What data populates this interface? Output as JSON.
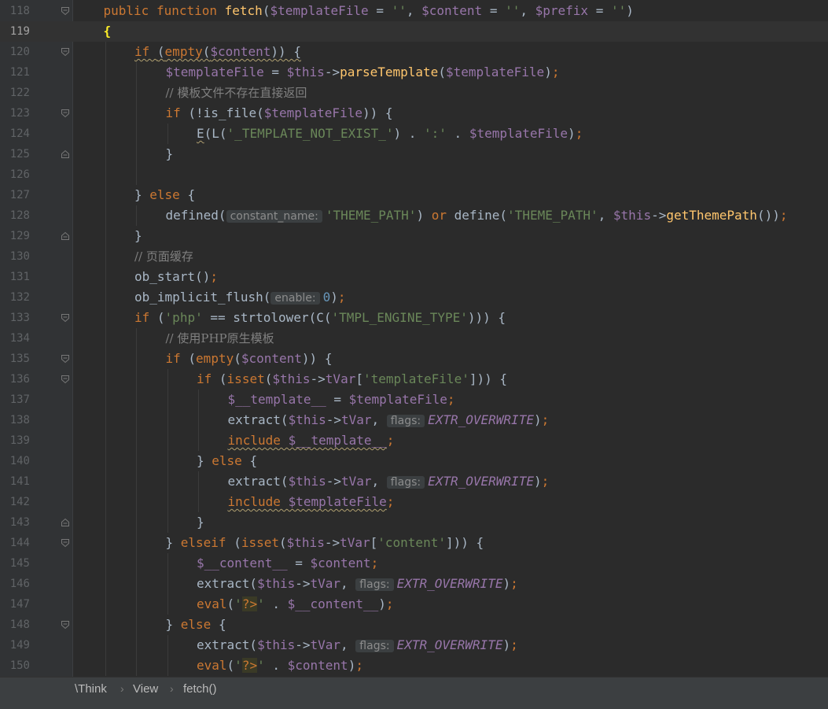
{
  "colors": {
    "background": "#2b2b2b",
    "gutter": "#313335",
    "keyword": "#cc7832",
    "function": "#ffc66d",
    "variable": "#9876aa",
    "string": "#6a8759",
    "number": "#6897bb",
    "comment": "#808080",
    "text": "#a9b7c6"
  },
  "current_line": 119,
  "breadcrumbs": [
    "\\Think",
    "View",
    "fetch()"
  ],
  "lines": [
    {
      "n": 118,
      "indent": 1,
      "fold": "open",
      "tokens": [
        [
          "kw",
          "public "
        ],
        [
          "kw",
          "function "
        ],
        [
          "fn",
          "fetch"
        ],
        [
          "plain",
          "("
        ],
        [
          "var",
          "$templateFile"
        ],
        [
          "plain",
          " = "
        ],
        [
          "str",
          "''"
        ],
        [
          "plain",
          ", "
        ],
        [
          "var",
          "$content"
        ],
        [
          "plain",
          " = "
        ],
        [
          "str",
          "''"
        ],
        [
          "plain",
          ", "
        ],
        [
          "var",
          "$prefix"
        ],
        [
          "plain",
          " = "
        ],
        [
          "str",
          "''"
        ],
        [
          "plain",
          ")"
        ]
      ]
    },
    {
      "n": 119,
      "indent": 1,
      "fold": "",
      "tokens": [
        [
          "hl",
          "{"
        ]
      ]
    },
    {
      "n": 120,
      "indent": 2,
      "fold": "open",
      "tokens": [
        [
          "kw",
          "if ",
          "w"
        ],
        [
          "plain",
          "(",
          "w"
        ],
        [
          "kw",
          "empty",
          "w"
        ],
        [
          "plain",
          "(",
          "w"
        ],
        [
          "var",
          "$content",
          "w"
        ],
        [
          "plain",
          ")) {",
          "w"
        ]
      ]
    },
    {
      "n": 121,
      "indent": 3,
      "fold": "",
      "tokens": [
        [
          "var",
          "$templateFile"
        ],
        [
          "plain",
          " = "
        ],
        [
          "var",
          "$this"
        ],
        [
          "plain",
          "->"
        ],
        [
          "fn",
          "parseTemplate"
        ],
        [
          "plain",
          "("
        ],
        [
          "var",
          "$templateFile"
        ],
        [
          "plain",
          ")"
        ],
        [
          "kw",
          ";"
        ]
      ]
    },
    {
      "n": 122,
      "indent": 3,
      "fold": "",
      "tokens": [
        [
          "cm",
          "// 模板文件不存在直接返回"
        ]
      ]
    },
    {
      "n": 123,
      "indent": 3,
      "fold": "open",
      "tokens": [
        [
          "kw",
          "if "
        ],
        [
          "plain",
          "(!is_file("
        ],
        [
          "var",
          "$templateFile"
        ],
        [
          "plain",
          ")) {"
        ]
      ]
    },
    {
      "n": 124,
      "indent": 4,
      "fold": "",
      "tokens": [
        [
          "plain",
          "E",
          "w"
        ],
        [
          "plain",
          "(L("
        ],
        [
          "str",
          "'_TEMPLATE_NOT_EXIST_'"
        ],
        [
          "plain",
          ") . "
        ],
        [
          "str",
          "':'"
        ],
        [
          "plain",
          " . "
        ],
        [
          "var",
          "$templateFile"
        ],
        [
          "plain",
          ")"
        ],
        [
          "kw",
          ";"
        ]
      ]
    },
    {
      "n": 125,
      "indent": 3,
      "fold": "close",
      "tokens": [
        [
          "plain",
          "}"
        ]
      ]
    },
    {
      "n": 126,
      "indent": 0,
      "fold": "",
      "tokens": []
    },
    {
      "n": 127,
      "indent": 2,
      "fold": "",
      "tokens": [
        [
          "plain",
          "} "
        ],
        [
          "kw",
          "else "
        ],
        [
          "plain",
          "{"
        ]
      ]
    },
    {
      "n": 128,
      "indent": 3,
      "fold": "",
      "tokens": [
        [
          "plain",
          "defined("
        ],
        [
          "hint",
          "constant_name:"
        ],
        [
          "str",
          "'THEME_PATH'"
        ],
        [
          "plain",
          ") "
        ],
        [
          "kw",
          "or "
        ],
        [
          "plain",
          "define("
        ],
        [
          "str",
          "'THEME_PATH'"
        ],
        [
          "plain",
          ", "
        ],
        [
          "var",
          "$this"
        ],
        [
          "plain",
          "->"
        ],
        [
          "fn",
          "getThemePath"
        ],
        [
          "plain",
          "())"
        ],
        [
          "kw",
          ";"
        ]
      ]
    },
    {
      "n": 129,
      "indent": 2,
      "fold": "close",
      "tokens": [
        [
          "plain",
          "}"
        ]
      ]
    },
    {
      "n": 130,
      "indent": 2,
      "fold": "",
      "tokens": [
        [
          "cm",
          "// 页面缓存"
        ]
      ]
    },
    {
      "n": 131,
      "indent": 2,
      "fold": "",
      "tokens": [
        [
          "plain",
          "ob_start()"
        ],
        [
          "kw",
          ";"
        ]
      ]
    },
    {
      "n": 132,
      "indent": 2,
      "fold": "",
      "tokens": [
        [
          "plain",
          "ob_implicit_flush("
        ],
        [
          "hint",
          "enable:"
        ],
        [
          "num",
          "0"
        ],
        [
          "plain",
          ")"
        ],
        [
          "kw",
          ";"
        ]
      ]
    },
    {
      "n": 133,
      "indent": 2,
      "fold": "open",
      "tokens": [
        [
          "kw",
          "if "
        ],
        [
          "plain",
          "("
        ],
        [
          "str",
          "'php'"
        ],
        [
          "plain",
          " == strtolower(C("
        ],
        [
          "str",
          "'TMPL_ENGINE_TYPE'"
        ],
        [
          "plain",
          "))) {"
        ]
      ]
    },
    {
      "n": 134,
      "indent": 3,
      "fold": "",
      "tokens": [
        [
          "cm",
          "// 使用PHP原生模板"
        ]
      ]
    },
    {
      "n": 135,
      "indent": 3,
      "fold": "open",
      "tokens": [
        [
          "kw",
          "if "
        ],
        [
          "plain",
          "("
        ],
        [
          "kw",
          "empty"
        ],
        [
          "plain",
          "("
        ],
        [
          "var",
          "$content"
        ],
        [
          "plain",
          ")) {"
        ]
      ]
    },
    {
      "n": 136,
      "indent": 4,
      "fold": "open",
      "tokens": [
        [
          "kw",
          "if "
        ],
        [
          "plain",
          "("
        ],
        [
          "kw",
          "isset"
        ],
        [
          "plain",
          "("
        ],
        [
          "var",
          "$this"
        ],
        [
          "plain",
          "->"
        ],
        [
          "var",
          "tVar"
        ],
        [
          "plain",
          "["
        ],
        [
          "str",
          "'templateFile'"
        ],
        [
          "plain",
          "])) {"
        ]
      ]
    },
    {
      "n": 137,
      "indent": 5,
      "fold": "",
      "tokens": [
        [
          "var",
          "$__template__"
        ],
        [
          "plain",
          " = "
        ],
        [
          "var",
          "$templateFile"
        ],
        [
          "kw",
          ";"
        ]
      ]
    },
    {
      "n": 138,
      "indent": 5,
      "fold": "",
      "tokens": [
        [
          "plain",
          "extract("
        ],
        [
          "var",
          "$this"
        ],
        [
          "plain",
          "->"
        ],
        [
          "var",
          "tVar"
        ],
        [
          "plain",
          ", "
        ],
        [
          "hint",
          "flags:"
        ],
        [
          "const",
          "EXTR_OVERWRITE"
        ],
        [
          "plain",
          ")"
        ],
        [
          "kw",
          ";"
        ]
      ]
    },
    {
      "n": 139,
      "indent": 5,
      "fold": "",
      "tokens": [
        [
          "kw",
          "include ",
          "w"
        ],
        [
          "var",
          "$__template__",
          "w"
        ],
        [
          "kw",
          ";"
        ]
      ]
    },
    {
      "n": 140,
      "indent": 4,
      "fold": "",
      "tokens": [
        [
          "plain",
          "} "
        ],
        [
          "kw",
          "else "
        ],
        [
          "plain",
          "{"
        ]
      ]
    },
    {
      "n": 141,
      "indent": 5,
      "fold": "",
      "tokens": [
        [
          "plain",
          "extract("
        ],
        [
          "var",
          "$this"
        ],
        [
          "plain",
          "->"
        ],
        [
          "var",
          "tVar"
        ],
        [
          "plain",
          ", "
        ],
        [
          "hint",
          "flags:"
        ],
        [
          "const",
          "EXTR_OVERWRITE"
        ],
        [
          "plain",
          ")"
        ],
        [
          "kw",
          ";"
        ]
      ]
    },
    {
      "n": 142,
      "indent": 5,
      "fold": "",
      "tokens": [
        [
          "kw",
          "include ",
          "w"
        ],
        [
          "var",
          "$templateFile",
          "w"
        ],
        [
          "kw",
          ";"
        ]
      ]
    },
    {
      "n": 143,
      "indent": 4,
      "fold": "close",
      "tokens": [
        [
          "plain",
          "}"
        ]
      ]
    },
    {
      "n": 144,
      "indent": 3,
      "fold": "open",
      "tokens": [
        [
          "plain",
          "} "
        ],
        [
          "kw",
          "elseif "
        ],
        [
          "plain",
          "("
        ],
        [
          "kw",
          "isset"
        ],
        [
          "plain",
          "("
        ],
        [
          "var",
          "$this"
        ],
        [
          "plain",
          "->"
        ],
        [
          "var",
          "tVar"
        ],
        [
          "plain",
          "["
        ],
        [
          "str",
          "'content'"
        ],
        [
          "plain",
          "])) {"
        ]
      ]
    },
    {
      "n": 145,
      "indent": 4,
      "fold": "",
      "tokens": [
        [
          "var",
          "$__content__"
        ],
        [
          "plain",
          " = "
        ],
        [
          "var",
          "$content"
        ],
        [
          "kw",
          ";"
        ]
      ]
    },
    {
      "n": 146,
      "indent": 4,
      "fold": "",
      "tokens": [
        [
          "plain",
          "extract("
        ],
        [
          "var",
          "$this"
        ],
        [
          "plain",
          "->"
        ],
        [
          "var",
          "tVar"
        ],
        [
          "plain",
          ", "
        ],
        [
          "hint",
          "flags:"
        ],
        [
          "const",
          "EXTR_OVERWRITE"
        ],
        [
          "plain",
          ")"
        ],
        [
          "kw",
          ";"
        ]
      ]
    },
    {
      "n": 147,
      "indent": 4,
      "fold": "",
      "tokens": [
        [
          "kw",
          "eval"
        ],
        [
          "plain",
          "("
        ],
        [
          "str",
          "'"
        ],
        [
          "esc",
          "?>"
        ],
        [
          "str",
          "'"
        ],
        [
          "plain",
          " . "
        ],
        [
          "var",
          "$__content__"
        ],
        [
          "plain",
          ")"
        ],
        [
          "kw",
          ";"
        ]
      ]
    },
    {
      "n": 148,
      "indent": 3,
      "fold": "open",
      "tokens": [
        [
          "plain",
          "} "
        ],
        [
          "kw",
          "else "
        ],
        [
          "plain",
          "{"
        ]
      ]
    },
    {
      "n": 149,
      "indent": 4,
      "fold": "",
      "tokens": [
        [
          "plain",
          "extract("
        ],
        [
          "var",
          "$this"
        ],
        [
          "plain",
          "->"
        ],
        [
          "var",
          "tVar"
        ],
        [
          "plain",
          ", "
        ],
        [
          "hint",
          "flags:"
        ],
        [
          "const",
          "EXTR_OVERWRITE"
        ],
        [
          "plain",
          ")"
        ],
        [
          "kw",
          ";"
        ]
      ]
    },
    {
      "n": 150,
      "indent": 4,
      "fold": "",
      "tokens": [
        [
          "kw",
          "eval"
        ],
        [
          "plain",
          "("
        ],
        [
          "str",
          "'"
        ],
        [
          "esc",
          "?>"
        ],
        [
          "str",
          "'"
        ],
        [
          "plain",
          " . "
        ],
        [
          "var",
          "$content"
        ],
        [
          "plain",
          ")"
        ],
        [
          "kw",
          ";"
        ]
      ]
    }
  ]
}
